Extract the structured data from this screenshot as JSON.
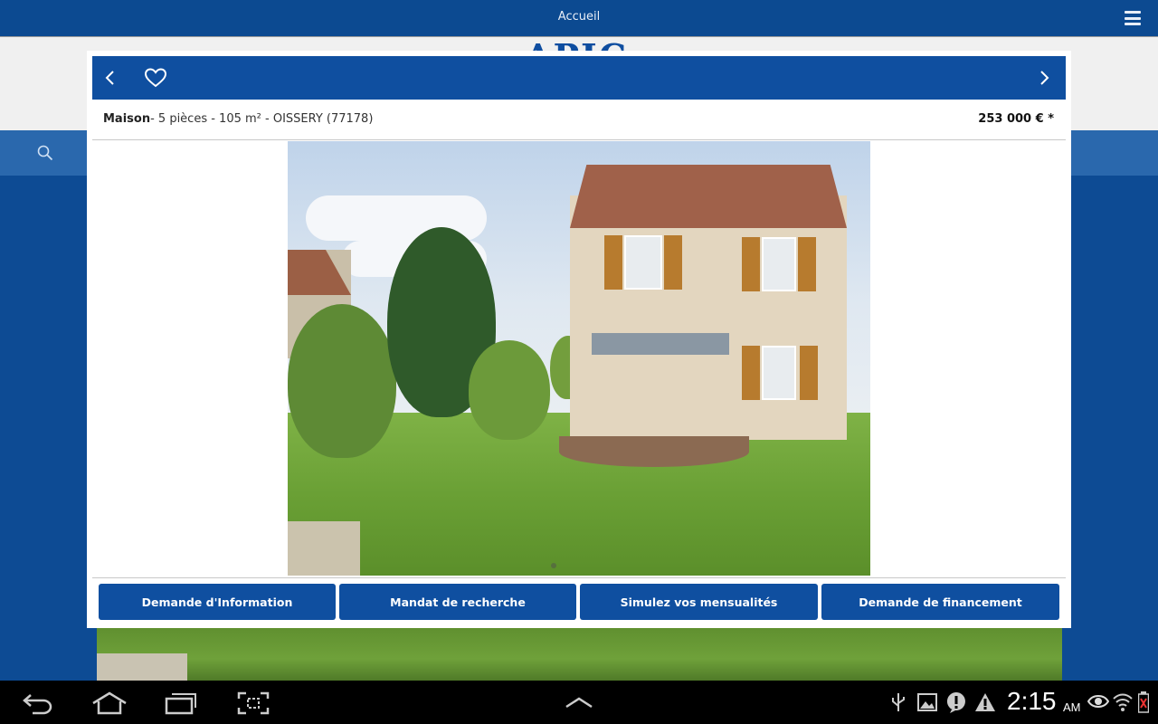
{
  "app": {
    "title": "Accueil",
    "logo_text": "APIC"
  },
  "listing": {
    "type": "Maison",
    "details": "- 5 pièces - 105 m² - ",
    "location": "OISSERY (77178)",
    "price": "253 000 € *"
  },
  "actions": [
    {
      "label": "Demande d'Information"
    },
    {
      "label": "Mandat de recherche"
    },
    {
      "label": "Simulez vos mensualités"
    },
    {
      "label": "Demande de financement"
    }
  ],
  "status_bar": {
    "time": "2:15",
    "ampm": "AM"
  },
  "colors": {
    "primary": "#0f4fa0",
    "appbar": "#0c4a91",
    "system_bar": "#000000"
  }
}
